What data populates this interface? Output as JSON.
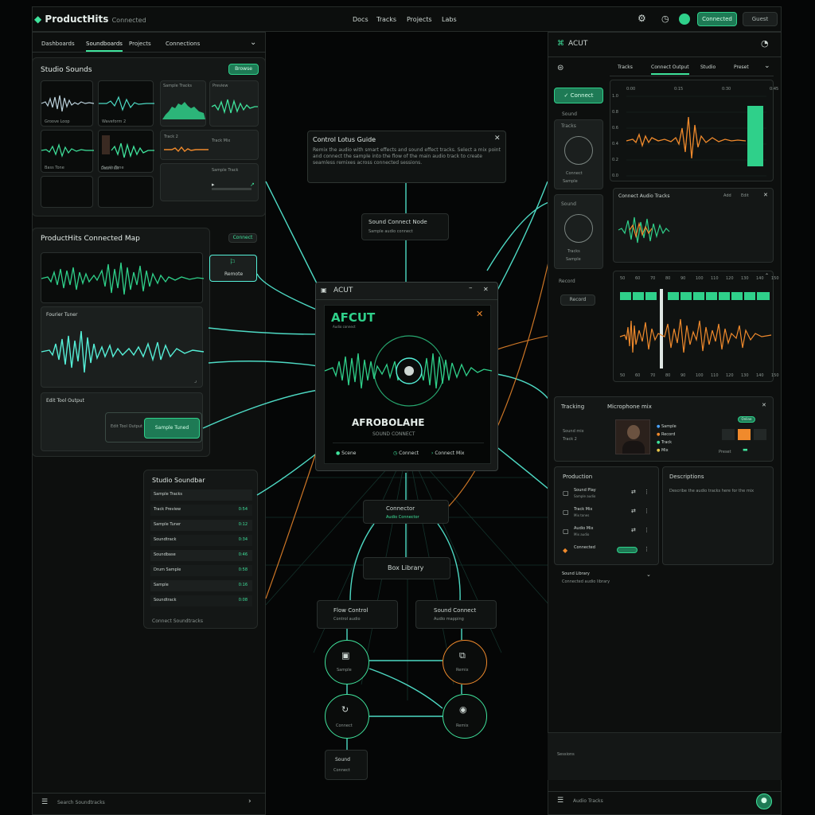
{
  "header": {
    "logo_text": "ProductHits",
    "logo_sub": "Connected",
    "nav": [
      "Docs",
      "Tracks",
      "Projects",
      "Labs"
    ],
    "cta_label": "Connected",
    "user_label": "Guest"
  },
  "left": {
    "tabs": [
      "Dashboards",
      "Soundboards",
      "Projects",
      "Connections"
    ],
    "studio_title": "Studio Sounds",
    "studio_action": "Browse",
    "thumb_captions": [
      "Groove Loop",
      "Waveform 2",
      "Bass Tone",
      "Synth Tone",
      "Drum Kit"
    ],
    "mini_labels": [
      "Sample Tracks",
      "Preview",
      "Track 2",
      "Track Mix",
      "Sample Track"
    ],
    "map_title": "ProductHits Connected Map",
    "map_badge": "Connect",
    "map_node_label": "Remote",
    "map_section_label": "Fourier Tuner",
    "map_bottom_label": "Edit Tool Output",
    "map_bottom_btn": "Sample Tuned",
    "queue_title": "Studio Soundbar",
    "queue_rows": [
      {
        "name": "Sample Tracks",
        "value": ""
      },
      {
        "name": "Track Preview",
        "value": "0:54"
      },
      {
        "name": "Sample Tuner",
        "value": "0:12"
      },
      {
        "name": "Soundtrack",
        "value": "0:34"
      },
      {
        "name": "Soundbase",
        "value": "0:46"
      },
      {
        "name": "Drum Sample",
        "value": "0:58"
      },
      {
        "name": "Sample",
        "value": "0:16"
      },
      {
        "name": "Soundtrack",
        "value": "0:08"
      }
    ],
    "queue_footer": "Connect Soundtracks",
    "footer_label": "Search Soundtracks"
  },
  "center": {
    "info_title": "Control Lotus Guide",
    "info_body": "Remix the audio with smart effects and sound effect tracks. Select a mix point and connect the sample into the flow of the main audio track to create seamless remixes across connected sessions.",
    "node_top_title": "Sound Connect Node",
    "node_top_sub": "Sample audio connect",
    "window_title": "ACUT",
    "brand_title": "AFCUT",
    "brand_sub": "Audio connect",
    "track_title": "AFROBOLAHE",
    "track_sub": "SOUND CONNECT",
    "chips": [
      "Scene",
      "Connect",
      "Connect Mix"
    ],
    "hub_title": "Connector",
    "hub_sub": "Audio Connector",
    "library_label": "Box Library",
    "flow_left_title": "Flow Control",
    "flow_left_sub": "Control audio",
    "flow_right_title": "Sound Connect",
    "flow_right_sub": "Audio mapping",
    "flow_nodes": [
      "Sample",
      "Remix",
      "Connect",
      "Remix"
    ],
    "flow_end_title": "Sound",
    "flow_end_sub": "Connect"
  },
  "right": {
    "title": "ACUT",
    "tabs": [
      "Tracks",
      "Connect Output",
      "Studio",
      "Preset"
    ],
    "side_active": "Connect",
    "side_labels": [
      "Sound",
      "Tracks",
      "Connect",
      "Sample",
      "Record"
    ],
    "side_btn": "Record",
    "axis_ticks": [
      "0:00",
      "0:15",
      "0:30",
      "0:45"
    ],
    "y_ticks": [
      "1.0",
      "0.8",
      "0.6",
      "0.4",
      "0.2",
      "0.0"
    ],
    "wave_card_title": "Connect Audio Tracks",
    "wave_card_actions": [
      "Add",
      "Edit"
    ],
    "meter_ticks": [
      "50",
      "60",
      "70",
      "80",
      "90",
      "100",
      "110",
      "120",
      "130",
      "140",
      "150"
    ],
    "player_left": "Tracking",
    "player_title": "Microphone mix",
    "player_lines": [
      "Sound mix",
      "Track 2",
      "Mixed 3"
    ],
    "player_items": [
      "Sample",
      "Record",
      "Track",
      "Mix"
    ],
    "player_status": "Online",
    "player_tail": "Preset",
    "tools_title": "Production",
    "tools": [
      "Sound Play",
      "Track Mix",
      "Audio Mix",
      "Connected"
    ],
    "tools_sub": [
      "Sample audio",
      "Mix tones",
      "Mix audio"
    ],
    "notes_title": "Descriptions",
    "notes_body": "Describe the audio tracks here for the mix",
    "expand_label": "Sound Library",
    "expand_sub": "Connected audio library",
    "bottom_label": "Sessions",
    "footer_label": "Audio Tracks"
  },
  "colors": {
    "accent": "#3fe39c",
    "cyan": "#55f0d8",
    "orange": "#f08a2c",
    "panel": "#141716",
    "bg": "#050606"
  }
}
